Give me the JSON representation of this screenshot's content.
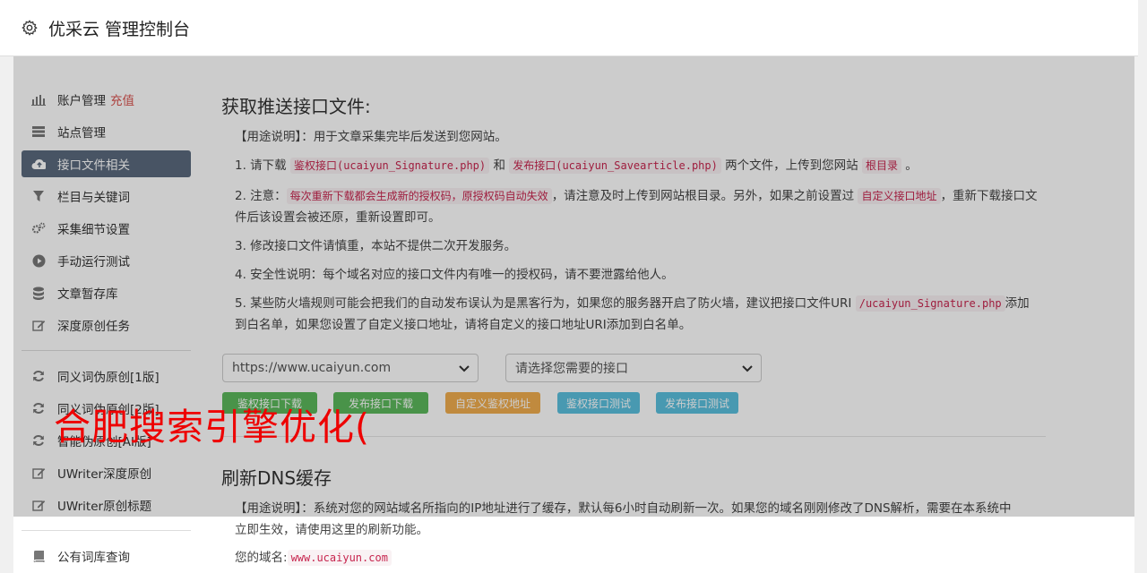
{
  "header": {
    "title": "优采云 管理控制台",
    "icon": "gear-icon"
  },
  "sidebar": {
    "items": [
      {
        "label": "账户管理",
        "tag": "充值",
        "icon": "bar-chart-icon"
      },
      {
        "label": "站点管理",
        "icon": "server-icon"
      },
      {
        "label": "接口文件相关",
        "icon": "cloud-upload-icon",
        "active": true
      },
      {
        "label": "栏目与关键词",
        "icon": "filter-icon"
      },
      {
        "label": "采集细节设置",
        "icon": "cogs-icon"
      },
      {
        "label": "手动运行测试",
        "icon": "play-circle-icon"
      },
      {
        "label": "文章暂存库",
        "icon": "database-icon"
      },
      {
        "label": "深度原创任务",
        "icon": "edit-icon"
      },
      {
        "label": "同义词伪原创[1版]",
        "icon": "refresh-icon"
      },
      {
        "label": "同义词伪原创[2版]",
        "icon": "refresh-icon"
      },
      {
        "label": "智能伪原创[AI版]",
        "icon": "refresh-icon"
      },
      {
        "label": "UWriter深度原创",
        "icon": "edit-icon"
      },
      {
        "label": "UWriter原创标题",
        "icon": "edit-icon"
      },
      {
        "label": "公有词库查询",
        "icon": "book-icon"
      }
    ]
  },
  "main": {
    "title": "获取推送接口文件:",
    "usage": "【用途说明】：用于文章采集完毕后发送到您网站。",
    "step1": {
      "a": "1. 请下载",
      "code1": "鉴权接口(ucaiyun_Signature.php)",
      "b": "和",
      "code2": "发布接口(ucaiyun_Savearticle.php)",
      "c": "两个文件，上传到您网站",
      "code3": "根目录",
      "d": "。"
    },
    "step2": {
      "a": "2. 注意：",
      "code1": "每次重新下载都会生成新的授权码，原授权码自动失效",
      "b": "，请注意及时上传到网站根目录。另外，如果之前设置过",
      "code2": "自定义接口地址",
      "c": "，重新下载接口文件后该设置会被还原，重新设置即可。"
    },
    "step3": "3. 修改接口文件请慎重，本站不提供二次开发服务。",
    "step4": "4. 安全性说明：每个域名对应的接口文件内有唯一的授权码，请不要泄露给他人。",
    "step5": {
      "a": "5. 某些防火墙规则可能会把我们的自动发布误认为是黑客行为，如果您的服务器开启了防火墙，建议把接口文件URI",
      "code1": "/ucaiyun_Signature.php",
      "b": "添加到白名单，如果您设置了自定义接口地址，请将自定义的接口地址URI添加到白名单。"
    },
    "site_select": "https://www.ucaiyun.com",
    "api_select": "请选择您需要的接口",
    "buttons": [
      {
        "label": "鉴权接口下载",
        "color": "#5cb85c"
      },
      {
        "label": "发布接口下载",
        "color": "#5cb85c"
      },
      {
        "label": "自定义鉴权地址",
        "color": "#f0ad4e"
      },
      {
        "label": "鉴权接口测试",
        "color": "#5bc0de"
      },
      {
        "label": "发布接口测试",
        "color": "#5bc0de"
      }
    ],
    "dns_title": "刷新DNS缓存",
    "dns_usage": "【用途说明】：系统对您的网站域名所指向的IP地址进行了缓存，默认每6小时自动刷新一次。如果您的域名刚刚修改了DNS解析，需要在本系统中立即生效，请使用这里的刷新功能。",
    "domain_label": "您的域名:",
    "domain_value": "www.ucaiyun.com"
  },
  "watermark": "合肥搜索引擎优化("
}
